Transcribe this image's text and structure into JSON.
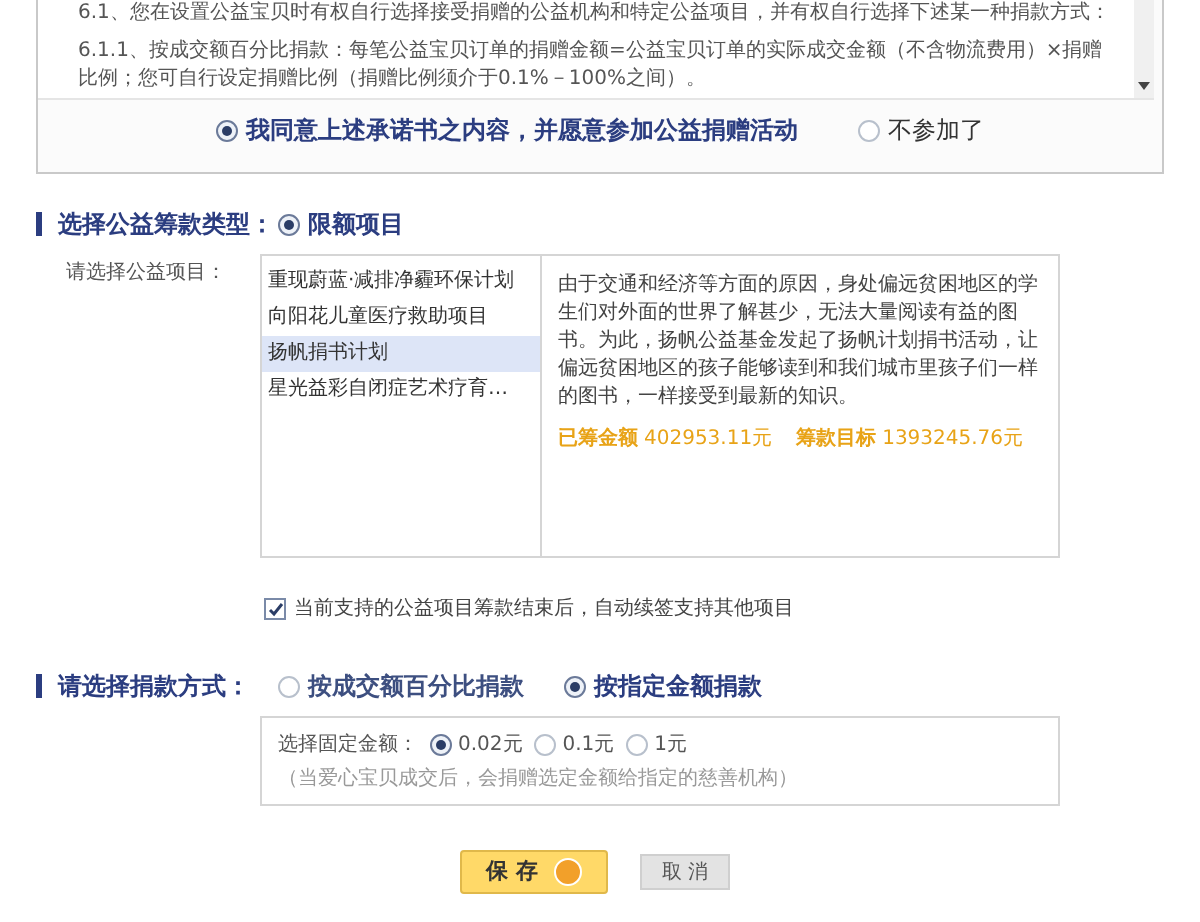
{
  "agreement": {
    "paragraphs": [
      "6.1、您在设置公益宝贝时有权自行选择接受捐赠的公益机构和特定公益项目，并有权自行选择下述某一种捐款方式：",
      "6.1.1、按成交额百分比捐款：每笔公益宝贝订单的捐赠金额=公益宝贝订单的实际成交金额（不含物流费用）×捐赠比例；您可自行设定捐赠比例（捐赠比例须介于0.1%－100%之间）。"
    ],
    "choices": [
      {
        "label": "我同意上述承诺书之内容，并愿意参加公益捐赠活动",
        "selected": true
      },
      {
        "label": "不参加了",
        "selected": false
      }
    ]
  },
  "fund_type": {
    "title": "选择公益筹款类型：",
    "options": [
      {
        "label": "限额项目",
        "selected": true
      }
    ]
  },
  "project": {
    "label": "请选择公益项目：",
    "items": [
      {
        "label": "重现蔚蓝·减排净霾环保计划",
        "selected": false
      },
      {
        "label": "向阳花儿童医疗救助项目",
        "selected": false
      },
      {
        "label": "扬帆捐书计划",
        "selected": true
      },
      {
        "label": "星光益彩自闭症艺术疗育…",
        "selected": false
      }
    ],
    "description": "由于交通和经济等方面的原因，身处偏远贫困地区的学生们对外面的世界了解甚少，无法大量阅读有益的图书。为此，扬帆公益基金发起了扬帆计划捐书活动，让偏远贫困地区的孩子能够读到和我们城市里孩子们一样的图书，一样接受到最新的知识。",
    "raised_label": "已筹金额",
    "raised": "402953.11元",
    "goal_label": "筹款目标",
    "goal": "1393245.76元"
  },
  "auto_switch": {
    "label": "当前支持的公益项目筹款结束后，自动续签支持其他项目",
    "checked": true
  },
  "donation_method": {
    "title": "请选择捐款方式：",
    "options": [
      {
        "label": "按成交额百分比捐款",
        "selected": false
      },
      {
        "label": "按指定金额捐款",
        "selected": true
      }
    ],
    "amount_label": "选择固定金额：",
    "amounts": [
      {
        "label": "0.02元",
        "selected": true
      },
      {
        "label": "0.1元",
        "selected": false
      },
      {
        "label": "1元",
        "selected": false
      }
    ],
    "note": "（当爱心宝贝成交后，会捐赠选定金额给指定的慈善机构）"
  },
  "buttons": {
    "save": "保 存",
    "cancel": "取 消"
  }
}
